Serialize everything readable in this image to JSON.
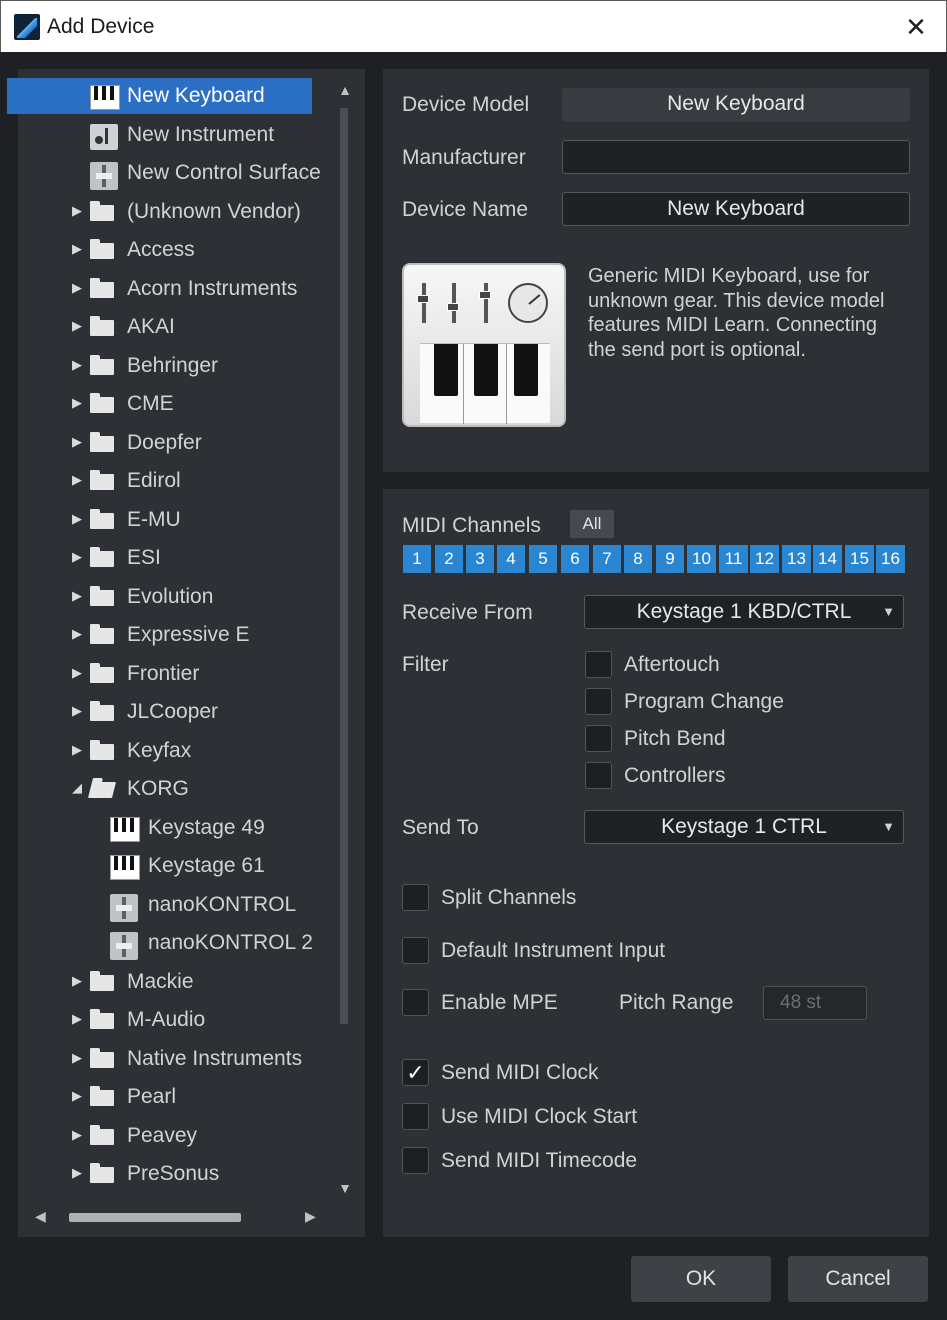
{
  "window": {
    "title": "Add Device",
    "close": "✕"
  },
  "tree": {
    "items": [
      {
        "label": "New Keyboard",
        "icon": "keyboard-icon",
        "selected": true
      },
      {
        "label": "New Instrument",
        "icon": "instrument-icon"
      },
      {
        "label": "New Control Surface",
        "icon": "control-surface-icon"
      },
      {
        "label": "(Unknown Vendor)",
        "icon": "folder-icon"
      },
      {
        "label": "Access",
        "icon": "folder-icon"
      },
      {
        "label": "Acorn Instruments",
        "icon": "folder-icon"
      },
      {
        "label": "AKAI",
        "icon": "folder-icon"
      },
      {
        "label": "Behringer",
        "icon": "folder-icon"
      },
      {
        "label": "CME",
        "icon": "folder-icon"
      },
      {
        "label": "Doepfer",
        "icon": "folder-icon"
      },
      {
        "label": "Edirol",
        "icon": "folder-icon"
      },
      {
        "label": "E-MU",
        "icon": "folder-icon"
      },
      {
        "label": "ESI",
        "icon": "folder-icon"
      },
      {
        "label": "Evolution",
        "icon": "folder-icon"
      },
      {
        "label": "Expressive E",
        "icon": "folder-icon"
      },
      {
        "label": "Frontier",
        "icon": "folder-icon"
      },
      {
        "label": "JLCooper",
        "icon": "folder-icon"
      },
      {
        "label": "Keyfax",
        "icon": "folder-icon"
      },
      {
        "label": "KORG",
        "icon": "folder-open-icon",
        "expanded": true
      },
      {
        "label": "Keystage 49",
        "icon": "keyboard-icon",
        "child": true
      },
      {
        "label": "Keystage 61",
        "icon": "keyboard-icon",
        "child": true
      },
      {
        "label": "nanoKONTROL",
        "icon": "control-surface-icon",
        "child": true
      },
      {
        "label": "nanoKONTROL 2",
        "icon": "control-surface-icon",
        "child": true
      },
      {
        "label": "Mackie",
        "icon": "folder-icon"
      },
      {
        "label": "M-Audio",
        "icon": "folder-icon"
      },
      {
        "label": "Native Instruments",
        "icon": "folder-icon"
      },
      {
        "label": "Pearl",
        "icon": "folder-icon"
      },
      {
        "label": "Peavey",
        "icon": "folder-icon"
      },
      {
        "label": "PreSonus",
        "icon": "folder-icon"
      }
    ]
  },
  "device": {
    "model_label": "Device Model",
    "model_value": "New Keyboard",
    "manufacturer_label": "Manufacturer",
    "manufacturer_value": "",
    "name_label": "Device Name",
    "name_value": "New Keyboard",
    "description": "Generic MIDI Keyboard, use for unknown gear. This device model features MIDI Learn. Connecting the send port is optional."
  },
  "midi": {
    "channels_label": "MIDI Channels",
    "all_label": "All",
    "channels": [
      "1",
      "2",
      "3",
      "4",
      "5",
      "6",
      "7",
      "8",
      "9",
      "10",
      "11",
      "12",
      "13",
      "14",
      "15",
      "16"
    ],
    "receive_label": "Receive From",
    "receive_value": "Keystage 1 KBD/CTRL",
    "filter_label": "Filter",
    "filters": [
      {
        "label": "Aftertouch",
        "checked": false
      },
      {
        "label": "Program Change",
        "checked": false
      },
      {
        "label": "Pitch Bend",
        "checked": false
      },
      {
        "label": "Controllers",
        "checked": false
      }
    ],
    "send_label": "Send To",
    "send_value": "Keystage 1 CTRL",
    "split_channels": {
      "label": "Split Channels",
      "checked": false
    },
    "default_instrument_input": {
      "label": "Default Instrument Input",
      "checked": false
    },
    "enable_mpe": {
      "label": "Enable MPE",
      "checked": false
    },
    "pitch_range_label": "Pitch Range",
    "pitch_range_value": "48 st",
    "send_midi_clock": {
      "label": "Send MIDI Clock",
      "checked": true
    },
    "use_midi_clock_start": {
      "label": "Use MIDI Clock Start",
      "checked": false
    },
    "send_midi_timecode": {
      "label": "Send MIDI Timecode",
      "checked": false
    }
  },
  "buttons": {
    "ok": "OK",
    "cancel": "Cancel"
  },
  "colors": {
    "accent": "#2a86d0",
    "selection": "#2a6fc4",
    "panel": "#2d3034",
    "background": "#1e2023"
  }
}
